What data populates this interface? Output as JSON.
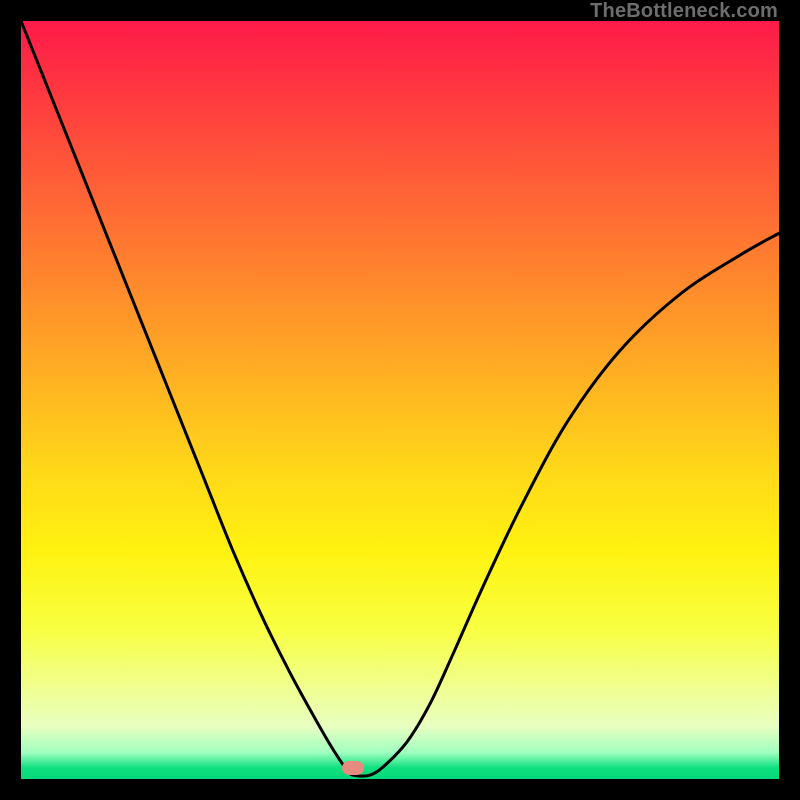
{
  "watermark": {
    "text": "TheBottleneck.com"
  },
  "colors": {
    "frameBorder": "#000000",
    "curveStroke": "#000000",
    "pill": "#e78b80",
    "gradientTop": "#ff1a4a",
    "gradientBottom": "#05d878"
  },
  "chart_data": {
    "type": "line",
    "title": "",
    "xlabel": "",
    "ylabel": "",
    "x_range": [
      0,
      1
    ],
    "y_range": [
      0,
      1
    ],
    "axes_visible": false,
    "grid": false,
    "marker": {
      "shape": "rounded-pill",
      "x": 0.438,
      "y": 0.015,
      "color": "#e78b80"
    },
    "series": [
      {
        "name": "bottleneck-curve",
        "color": "#000000",
        "stroke_width": 3,
        "x": [
          0.0,
          0.04,
          0.08,
          0.12,
          0.16,
          0.2,
          0.24,
          0.28,
          0.32,
          0.355,
          0.385,
          0.405,
          0.42,
          0.43,
          0.438,
          0.46,
          0.48,
          0.51,
          0.54,
          0.57,
          0.61,
          0.66,
          0.72,
          0.79,
          0.87,
          0.95,
          1.0
        ],
        "y": [
          1.0,
          0.9,
          0.8,
          0.7,
          0.6,
          0.5,
          0.4,
          0.3,
          0.21,
          0.14,
          0.085,
          0.05,
          0.026,
          0.012,
          0.005,
          0.005,
          0.018,
          0.05,
          0.1,
          0.165,
          0.255,
          0.36,
          0.47,
          0.565,
          0.64,
          0.692,
          0.72
        ]
      }
    ]
  }
}
